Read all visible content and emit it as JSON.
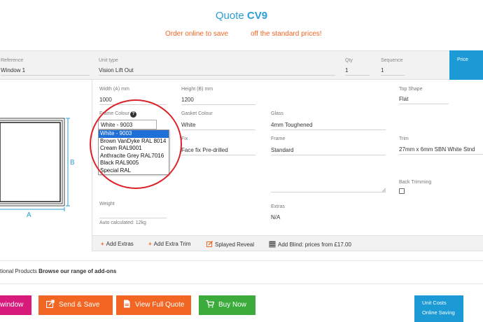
{
  "header": {
    "title_prefix": "Quote",
    "title_code": "CV9",
    "promo_left": "Order online to save",
    "promo_right": "off the standard prices!"
  },
  "fields_row": {
    "reference_label": "Reference",
    "reference_value": "Window 1",
    "unit_type_label": "Unit type",
    "unit_type_value": "Vision Lift Out",
    "qty_label": "Qty",
    "qty_value": "1",
    "sequence_label": "Sequence",
    "sequence_value": "1",
    "price_label": "Price"
  },
  "diagram": {
    "width_marker": "A",
    "height_marker": "B"
  },
  "form": {
    "width_label": "Width (A) mm",
    "width_value": "1000",
    "height_label": "Height (B) mm",
    "height_value": "1200",
    "top_shape_label": "Top Shape",
    "top_shape_value": "Flat",
    "frame_colour_label": "Frame Colour",
    "frame_colour_value": "White - 9003",
    "frame_colour_options": [
      "White - 9003",
      "Brown VanDyke RAL 8014",
      "Cream RAL9001",
      "Anthracite Grey RAL7016",
      "Black RAL9005",
      "Special RAL"
    ],
    "gasket_colour_label": "Gasket Colour",
    "gasket_colour_value": "White",
    "glass_label": "Glass",
    "glass_value": "4mm Toughened",
    "fix_label": "Fix",
    "fix_value": "Face fix Pre-drilled",
    "frame_label": "Frame",
    "frame_value": "Standard",
    "trim_label": "Trim",
    "trim_value": "27mm x 6mm SBN White Stnd",
    "back_trimming_label": "Back Trimming",
    "weight_label": "Weight",
    "weight_note": "Auto calculated: 12kg",
    "extras_label": "Extras",
    "extras_value": "N/A"
  },
  "extras_bar": {
    "add_extras": "Add Extras",
    "add_extra_trim": "Add Extra Trim",
    "splayed_reveal": "Splayed Reveal",
    "add_blind": "Add Blind: prices from £17.00"
  },
  "addons": {
    "prefix": "tional Products",
    "link": "Browse our range of add-ons"
  },
  "buttons": {
    "window": "window",
    "send_save": "Send & Save",
    "view_full_quote": "View Full Quote",
    "buy_now": "Buy Now"
  },
  "sidebar_box": {
    "unit_costs": "Unit Costs",
    "online_saving": "Online Saving"
  },
  "colors": {
    "accent_blue": "#1b9ad6",
    "promo_orange": "#f26522",
    "button_pink": "#d81b7a",
    "button_orange": "#f26522",
    "button_green": "#3bab3b",
    "highlight_red": "#d9222a"
  }
}
